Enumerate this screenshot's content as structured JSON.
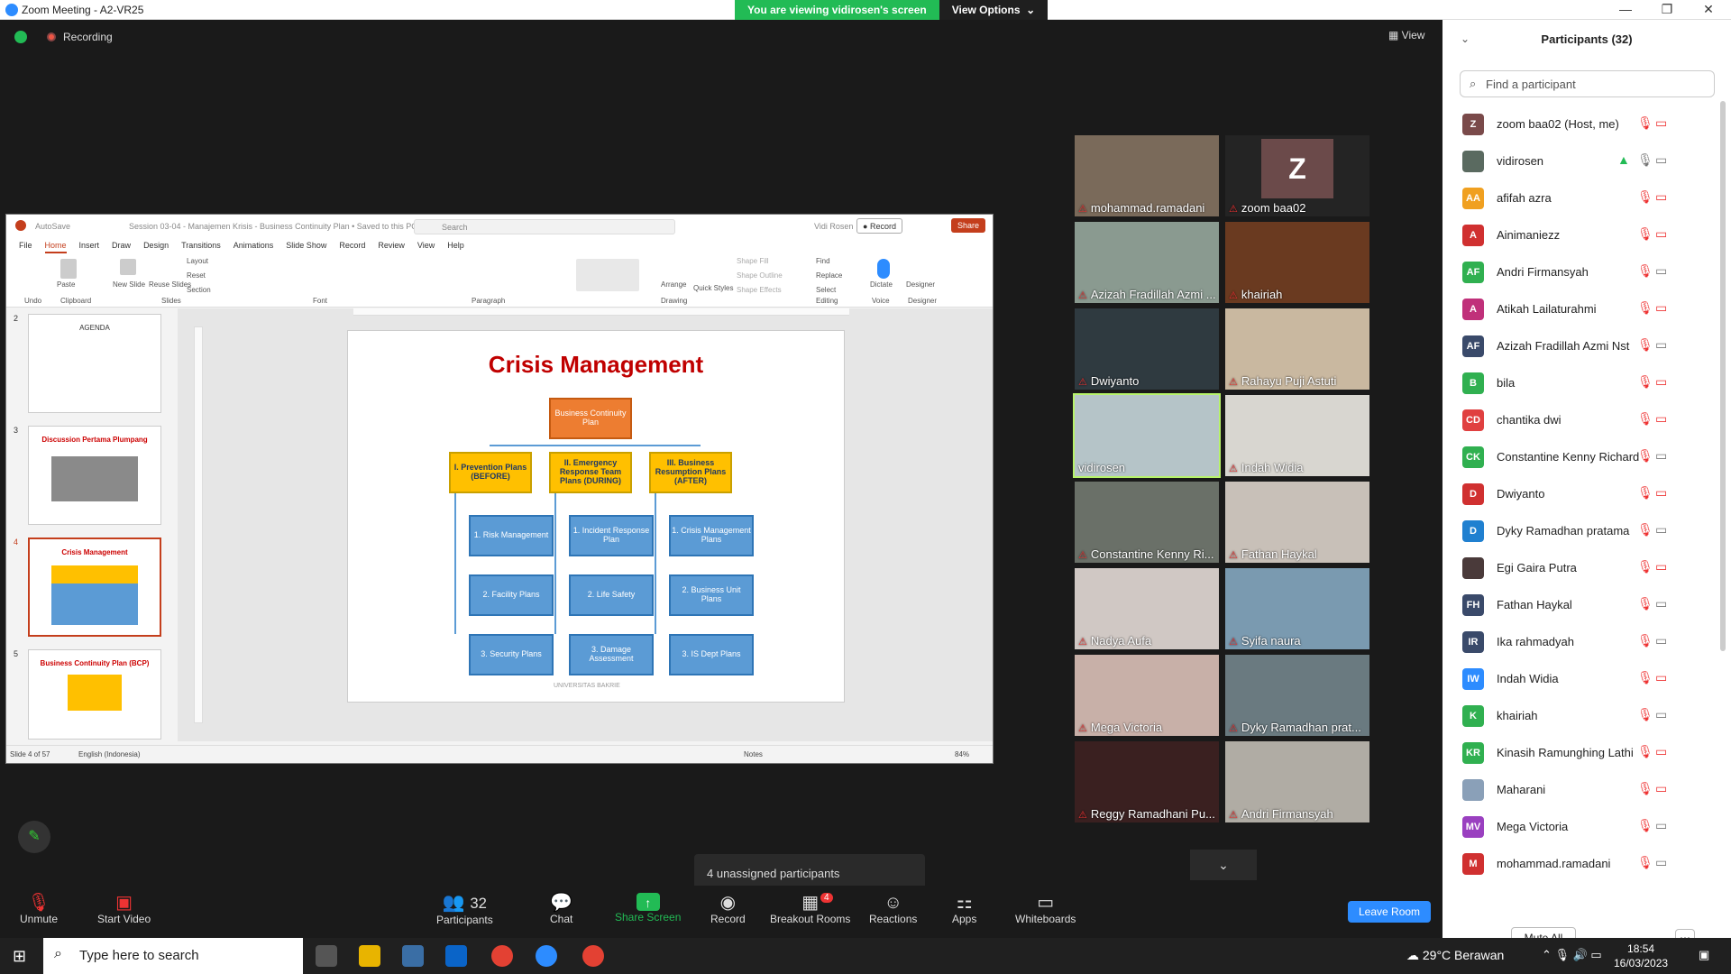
{
  "window": {
    "title": "Zoom Meeting - A2-VR25"
  },
  "banner": {
    "viewing": "You are viewing vidirosen's screen",
    "view_options": "View Options"
  },
  "top": {
    "recording": "Recording",
    "view": "View"
  },
  "ppt": {
    "autosave": "AutoSave",
    "doc_title": "Session 03-04 - Manajemen Krisis - Business Continuity Plan • Saved to this PC",
    "search_placeholder": "Search",
    "user": "Vidi Rosen",
    "record": "Record",
    "share": "Share",
    "menu": [
      "File",
      "Home",
      "Insert",
      "Draw",
      "Design",
      "Transitions",
      "Animations",
      "Slide Show",
      "Record",
      "Review",
      "View",
      "Help"
    ],
    "groups": [
      "Undo",
      "Clipboard",
      "Slides",
      "Font",
      "Paragraph",
      "Drawing",
      "Editing",
      "Voice",
      "Designer"
    ],
    "ribbon": {
      "paste": "Paste",
      "new_slide": "New Slide",
      "reuse": "Reuse Slides",
      "layout": "Layout",
      "reset": "Reset",
      "section": "Section",
      "arrange": "Arrange",
      "quick_styles": "Quick Styles",
      "shape_fill": "Shape Fill",
      "shape_outline": "Shape Outline",
      "shape_effects": "Shape Effects",
      "find": "Find",
      "replace": "Replace",
      "select": "Select",
      "dictate": "Dictate",
      "designer": "Designer"
    },
    "thumbs": [
      {
        "num": "2",
        "title": "AGENDA"
      },
      {
        "num": "3",
        "title": "Discussion Pertama Plumpang"
      },
      {
        "num": "4",
        "title": "Crisis Management"
      },
      {
        "num": "5",
        "title": "Business Continuity Plan (BCP)"
      }
    ],
    "slide": {
      "title": "Crisis Management",
      "top": "Business Continuity Plan",
      "col1": "I. Prevention Plans (BEFORE)",
      "col2": "II. Emergency Response Team Plans (DURING)",
      "col3": "III. Business Resumption Plans (AFTER)",
      "c1": [
        "1. Risk Management",
        "2. Facility Plans",
        "3. Security Plans"
      ],
      "c2": [
        "1. Incident Response Plan",
        "2. Life Safety",
        "3. Damage Assessment"
      ],
      "c3": [
        "1. Crisis Management Plans",
        "2. Business Unit Plans",
        "3. IS Dept Plans"
      ],
      "logo": "UNIVERSITAS BAKRIE"
    },
    "status": {
      "slide": "Slide 4 of 57",
      "lang": "English (Indonesia)",
      "notes": "Notes",
      "zoom": "84%"
    }
  },
  "tiles": [
    {
      "name": "mohammad.ramadani",
      "color": "#7a6a5a"
    },
    {
      "name": "zoom baa02",
      "color": "#242424"
    },
    {
      "name": "Azizah Fradillah Azmi ...",
      "color": "#8a9a90"
    },
    {
      "name": "khairiah",
      "color": "#6a3a20"
    },
    {
      "name": "Dwiyanto",
      "color": "#2f3a40"
    },
    {
      "name": "Rahayu Puji Astuti",
      "color": "#c9b8a0"
    },
    {
      "name": "vidirosen",
      "color": "#b5c4c8"
    },
    {
      "name": "Indah Widia",
      "color": "#d8d6d0"
    },
    {
      "name": "Constantine Kenny Ri...",
      "color": "#6a7068"
    },
    {
      "name": "Fathan Haykal",
      "color": "#c8c0b8"
    },
    {
      "name": "Nadya Aufa",
      "color": "#d0c8c4"
    },
    {
      "name": "Syifa naura",
      "color": "#7a9ab0"
    },
    {
      "name": "Mega Victoria",
      "color": "#c8b0a8"
    },
    {
      "name": "Dyky Ramadhan prat...",
      "color": "#6a7a80"
    },
    {
      "name": "Reggy Ramadhani Pu...",
      "color": "#3a2020"
    },
    {
      "name": "Andri Firmansyah",
      "color": "#b0aca4"
    }
  ],
  "avatar_letter": "Z",
  "tooltip": "4 unassigned participants",
  "toolbar": {
    "unmute": "Unmute",
    "start_video": "Start Video",
    "participants": "Participants",
    "participants_count": "32",
    "chat": "Chat",
    "share": "Share Screen",
    "record": "Record",
    "breakout": "Breakout Rooms",
    "breakout_badge": "4",
    "reactions": "Reactions",
    "apps": "Apps",
    "whiteboards": "Whiteboards",
    "leave": "Leave Room"
  },
  "panel": {
    "title": "Participants (32)",
    "search_placeholder": "Find a participant",
    "mute_all": "Mute All",
    "participants": [
      {
        "initials": "Z",
        "name": "zoom baa02 (Host, me)",
        "color": "#7a4a4a"
      },
      {
        "initials": "",
        "name": "vidirosen",
        "color": "#5a6a60"
      },
      {
        "initials": "AA",
        "name": "afifah azra",
        "color": "#f0a020"
      },
      {
        "initials": "A",
        "name": "Ainimaniezz",
        "color": "#d03030"
      },
      {
        "initials": "AF",
        "name": "Andri Firmansyah",
        "color": "#30b050"
      },
      {
        "initials": "A",
        "name": "Atikah Lailaturahmi",
        "color": "#c0307a"
      },
      {
        "initials": "AF",
        "name": "Azizah Fradillah Azmi Nst",
        "color": "#3a4a6a"
      },
      {
        "initials": "B",
        "name": "bila",
        "color": "#30b050"
      },
      {
        "initials": "CD",
        "name": "chantika dwi",
        "color": "#e04040"
      },
      {
        "initials": "CK",
        "name": "Constantine Kenny Richard",
        "color": "#30b050"
      },
      {
        "initials": "D",
        "name": "Dwiyanto",
        "color": "#d03030"
      },
      {
        "initials": "D",
        "name": "Dyky Ramadhan pratama",
        "color": "#2080d0"
      },
      {
        "initials": "",
        "name": "Egi Gaira Putra",
        "color": "#4a3a3a"
      },
      {
        "initials": "FH",
        "name": "Fathan Haykal",
        "color": "#3a4a6a"
      },
      {
        "initials": "IR",
        "name": "Ika rahmadyah",
        "color": "#3a4a6a"
      },
      {
        "initials": "IW",
        "name": "Indah Widia",
        "color": "#2d8cff"
      },
      {
        "initials": "K",
        "name": "khairiah",
        "color": "#30b050"
      },
      {
        "initials": "KR",
        "name": "Kinasih Ramunghing Lathi",
        "color": "#30b050"
      },
      {
        "initials": "",
        "name": "Maharani",
        "color": "#8aa0b8"
      },
      {
        "initials": "MV",
        "name": "Mega Victoria",
        "color": "#9a40c0"
      },
      {
        "initials": "M",
        "name": "mohammad.ramadani",
        "color": "#d03030"
      }
    ]
  },
  "taskbar": {
    "search": "Type here to search",
    "weather": "29°C Berawan",
    "time": "18:54",
    "date": "16/03/2023"
  }
}
